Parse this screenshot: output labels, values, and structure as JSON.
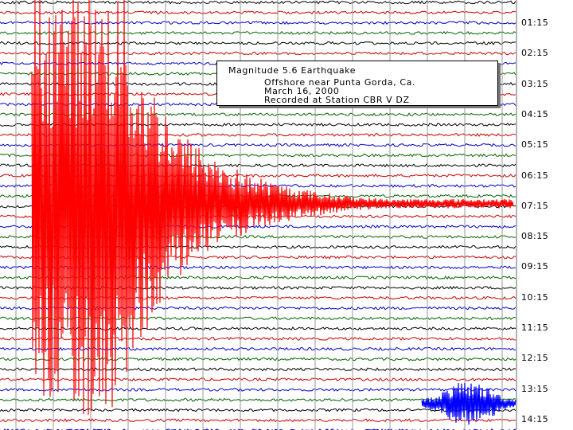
{
  "chart_data": {
    "type": "line",
    "title": "Magnitude 5.6 Earthquake",
    "subtitle": [
      "Offshore near Punta Gorda, Ca.",
      "March 16, 2000",
      "Recorded at Station CBR V DZ"
    ],
    "row_labels": [
      "01:15",
      "02:15",
      "03:15",
      "04:15",
      "05:15",
      "06:15",
      "07:15",
      "08:15",
      "09:15",
      "10:15",
      "11:15",
      "12:15",
      "13:15",
      "14:15"
    ],
    "series_colors": [
      "#000000",
      "#cc0000",
      "#0000cc",
      "#006600"
    ],
    "event_color": "#ff0000",
    "event_baseline_label": "07:15",
    "late_event_color": "#0000ff",
    "late_event_label": "13:15",
    "grid": true,
    "grid_color": "#999999"
  }
}
